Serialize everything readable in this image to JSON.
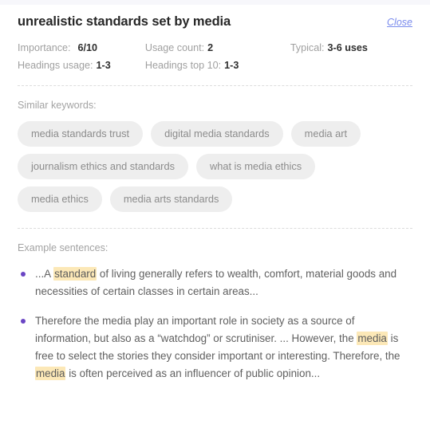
{
  "panel": {
    "title": "unrealistic standards set by media",
    "close_label": "Close"
  },
  "stats": {
    "importance": {
      "label": "Importance:",
      "value": "6/10"
    },
    "usage_count": {
      "label": "Usage count:",
      "value": "2"
    },
    "typical": {
      "label": "Typical:",
      "value": "3-6 uses"
    },
    "headings_usage": {
      "label": "Headings usage:",
      "value": "1-3"
    },
    "headings_top10": {
      "label": "Headings top 10:",
      "value": "1-3"
    }
  },
  "similar_keywords": {
    "label": "Similar keywords:",
    "items": [
      "media standards trust",
      "digital media standards",
      "media art",
      "journalism ethics and standards",
      "what is media ethics",
      "media ethics",
      "media arts standards"
    ]
  },
  "examples": {
    "label": "Example sentences:",
    "items": [
      {
        "parts": [
          {
            "text": "...A ",
            "highlight": false
          },
          {
            "text": "standard",
            "highlight": true
          },
          {
            "text": " of living generally refers to wealth, comfort, material goods and necessities of certain classes in certain areas...",
            "highlight": false
          }
        ]
      },
      {
        "parts": [
          {
            "text": "Therefore the media play an important role in society as a source of information, but also as a “watchdog” or scrutiniser. ... However, the ",
            "highlight": false
          },
          {
            "text": "media",
            "highlight": true
          },
          {
            "text": " is free to select the stories they consider important or interesting. Therefore, the ",
            "highlight": false
          },
          {
            "text": "media",
            "highlight": true
          },
          {
            "text": " is often perceived as an influencer of public opinion...",
            "highlight": false
          }
        ]
      }
    ]
  },
  "colors": {
    "title": "#262626",
    "close_link": "#7b8ced",
    "muted_text": "#a0a0a0",
    "value_text": "#2e2e2e",
    "chip_bg": "#eeeeee",
    "chip_text": "#8c8c8c",
    "bullet": "#6a45c4",
    "highlight_bg": "#fce8b7",
    "divider": "#dcdcdc",
    "body_text": "#606060"
  }
}
